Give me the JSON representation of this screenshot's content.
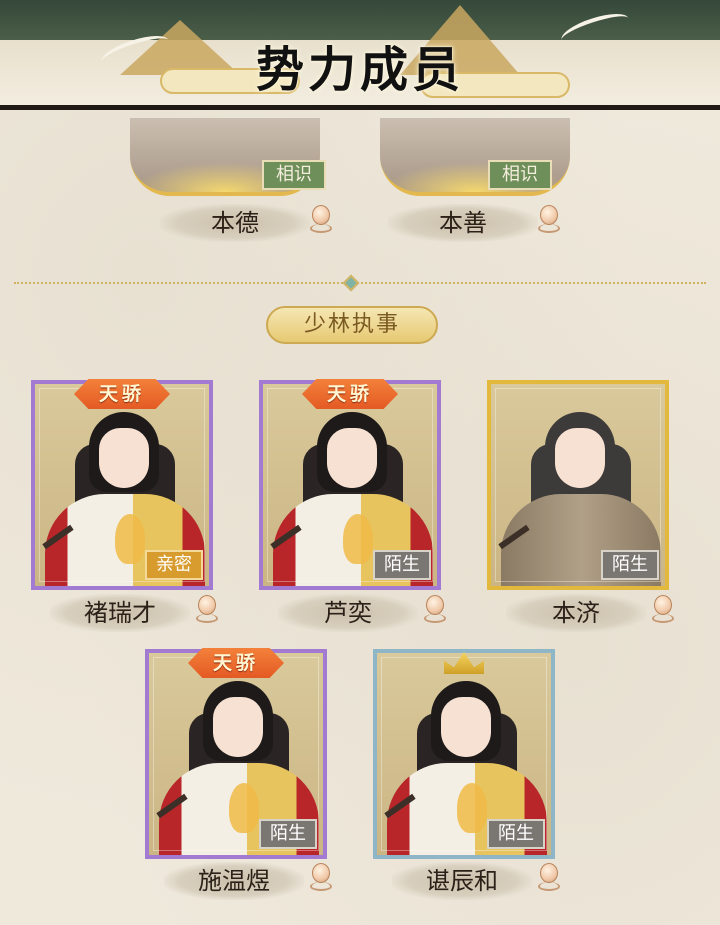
{
  "header": {
    "title": "势力成员"
  },
  "top_members": [
    {
      "name": "本德",
      "relation": "相识"
    },
    {
      "name": "本善",
      "relation": "相识"
    }
  ],
  "section": {
    "label": "少林执事"
  },
  "members": [
    {
      "name": "褚瑞才",
      "relation": "亲密",
      "badge": "天骄",
      "frame": "purple"
    },
    {
      "name": "芦奕",
      "relation": "陌生",
      "badge": "天骄",
      "frame": "purple"
    },
    {
      "name": "本济",
      "relation": "陌生",
      "frame": "gold"
    },
    {
      "name": "施温煜",
      "relation": "陌生",
      "badge": "天骄",
      "frame": "purple"
    },
    {
      "name": "谌辰和",
      "relation": "陌生",
      "frame": "blue"
    }
  ],
  "colors": {
    "frame_purple": "#a37ad1",
    "frame_gold": "#e2b93c",
    "frame_blue": "#8fb6c6",
    "badge_orange": "#e45a24",
    "tag_intimate": "#d89b2e",
    "tag_stranger": "#7a7671",
    "tag_acquaintance": "#6e8f5a"
  },
  "icons": {
    "gift": "gift-pin-icon",
    "crown": "crown-icon"
  }
}
